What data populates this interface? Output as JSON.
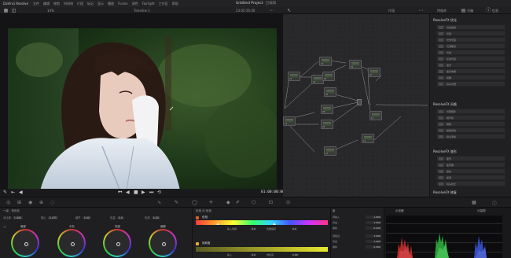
{
  "menubar": {
    "app": "DaVinci Resolve",
    "items": [
      "文件",
      "编辑",
      "修剪",
      "时间线",
      "片段",
      "标记",
      "显示",
      "播放",
      "Fusion",
      "调色",
      "Fairlight",
      "工作区",
      "帮助"
    ],
    "project_title": "Untitled Project",
    "edited_label": "已编辑"
  },
  "toolbar": {
    "zoom": "14%",
    "timeline": "Timeline 1",
    "timecode_top": "23:05:56:00",
    "clip_label": "片段",
    "panel_label": "特效库",
    "lightbox_label": "光箱",
    "info_label": "信息",
    "node_mode": "片段"
  },
  "transport": {
    "timecode": "01:00:00:00"
  },
  "nodes": [
    {
      "label": "01"
    },
    {
      "label": "02"
    },
    {
      "label": "03"
    },
    {
      "label": "04"
    },
    {
      "label": "05"
    },
    {
      "label": "06"
    },
    {
      "label": "07"
    },
    {
      "label": "08"
    },
    {
      "label": "09"
    },
    {
      "label": "10"
    },
    {
      "label": "11"
    },
    {
      "label": "12"
    },
    {
      "label": "13"
    }
  ],
  "fx_panel": {
    "section1": "ResolveFX 优化",
    "section1_items": [
      "光线追踪",
      "光斑",
      "光学光晕",
      "光源照射",
      "光线",
      "反射光晕",
      "发光",
      "发光效果",
      "模糊",
      "镜头光斑"
    ],
    "section2": "ResolveFX 风格",
    "section2_items": [
      "光照阴影",
      "地平线",
      "暗角",
      "模拟损伤",
      "噪点添加"
    ],
    "section3": "ResolveFX 变形",
    "section3_items": [
      "变形",
      "变形器",
      "波纹",
      "漩涡",
      "镜头校正"
    ],
    "section4": "ResolveFX 修复"
  },
  "wheels": {
    "title": "一级 - 校色轮",
    "params": [
      {
        "label": "对比度",
        "value": "1.000"
      },
      {
        "label": "轴心",
        "value": "0.435"
      },
      {
        "label": "细节",
        "value": "0.00"
      },
      {
        "label": "色温",
        "value": "0.0"
      },
      {
        "label": "色调",
        "value": "0.00"
      }
    ],
    "labels": [
      "暗部",
      "中灰",
      "亮部",
      "偏移"
    ]
  },
  "hsl": {
    "title": "色相 对 色相",
    "row1": "色相",
    "row1_vals": {
      "in_label": "输入色相",
      "in": "0.0",
      "out_label": "色相旋转",
      "out": "0.0"
    },
    "row2": "饱和度",
    "row2_vals": {
      "in_label": "输入",
      "in": "0.0",
      "out_label": "饱和度",
      "out": "1.00"
    }
  },
  "keys": {
    "title": "键",
    "rows": [
      {
        "label": "键输入",
        "value": "1.000"
      },
      {
        "label": "增益",
        "value": "1.000"
      },
      {
        "label": "偏移",
        "value": "0.000"
      },
      {
        "label": "键输出",
        "value": "1.000"
      },
      {
        "label": "增益",
        "value": "1.000"
      },
      {
        "label": "偏移",
        "value": "0.000"
      }
    ]
  },
  "scope": {
    "title": "示波器",
    "mode": "分量图"
  },
  "colors": {
    "accent": "#e85c2a",
    "panel": "#1f1f21",
    "node_bg": "#28282a"
  }
}
